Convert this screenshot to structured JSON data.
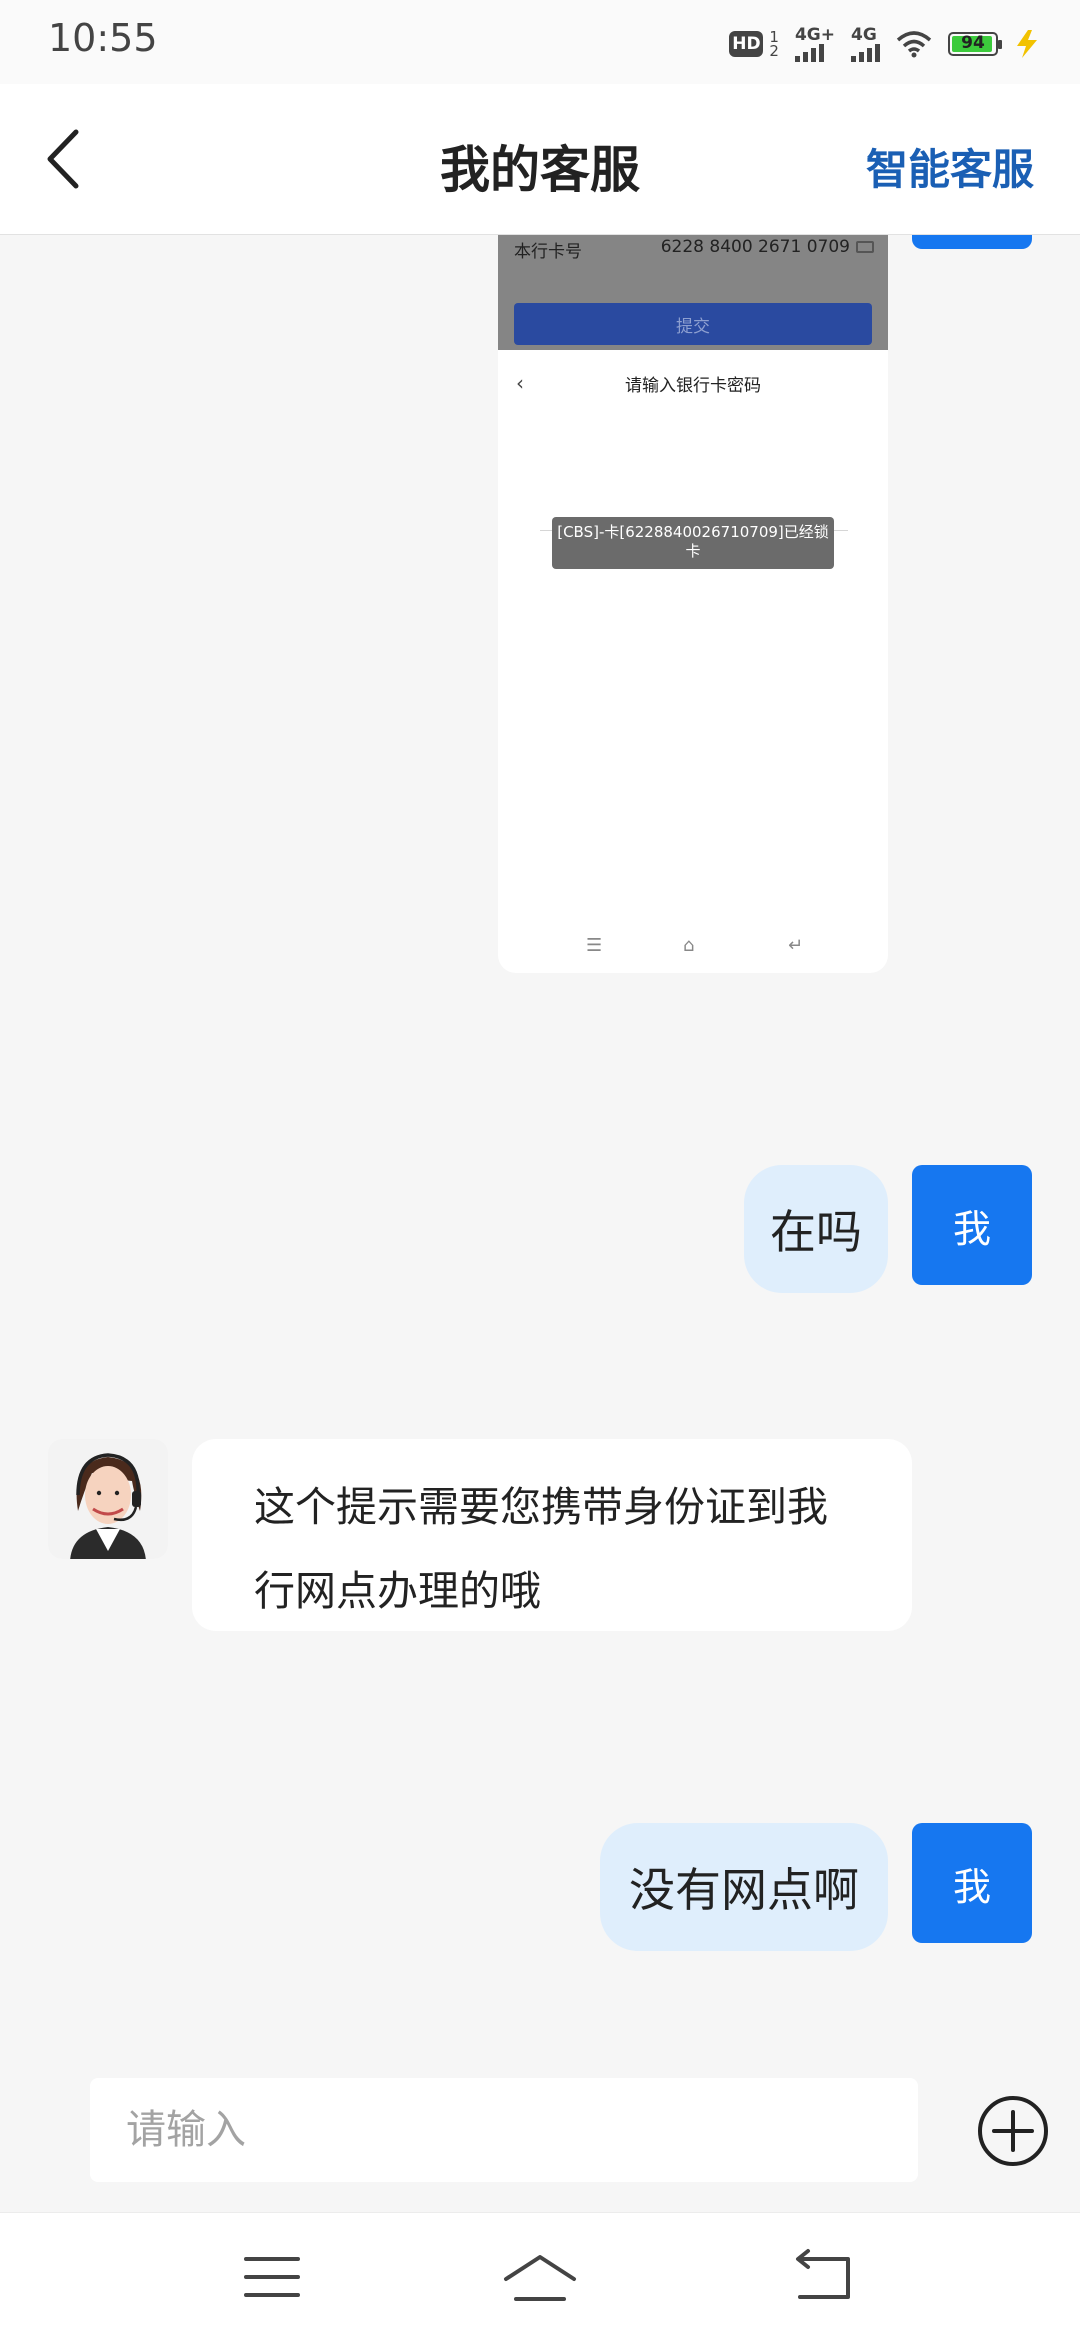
{
  "status_bar": {
    "time": "10:55",
    "hd_label": "HD",
    "sim_numbers": [
      "1",
      "2"
    ],
    "network1": "4G+",
    "network2": "4G",
    "battery": "94"
  },
  "header": {
    "title": "我的客服",
    "smart_service": "智能客服"
  },
  "screenshot": {
    "card_label": "本行卡号",
    "card_value": "6228 8400 2671 0709",
    "submit_label": "提交",
    "page_title": "请输入银行卡密码",
    "toast": "[CBS]-卡[6228840026710709]已经锁卡"
  },
  "messages": [
    {
      "from": "me",
      "avatar_label": "我",
      "text": "在吗"
    },
    {
      "from": "agent",
      "text": "这个提示需要您携带身份证到我行网点办理的哦"
    },
    {
      "from": "me",
      "avatar_label": "我",
      "text": "没有网点啊"
    }
  ],
  "input": {
    "placeholder": "请输入"
  },
  "colors": {
    "accent": "#1677f0",
    "title_link": "#1a5fb4",
    "my_bubble": "#dfeefc",
    "background": "#f6f6f6"
  }
}
